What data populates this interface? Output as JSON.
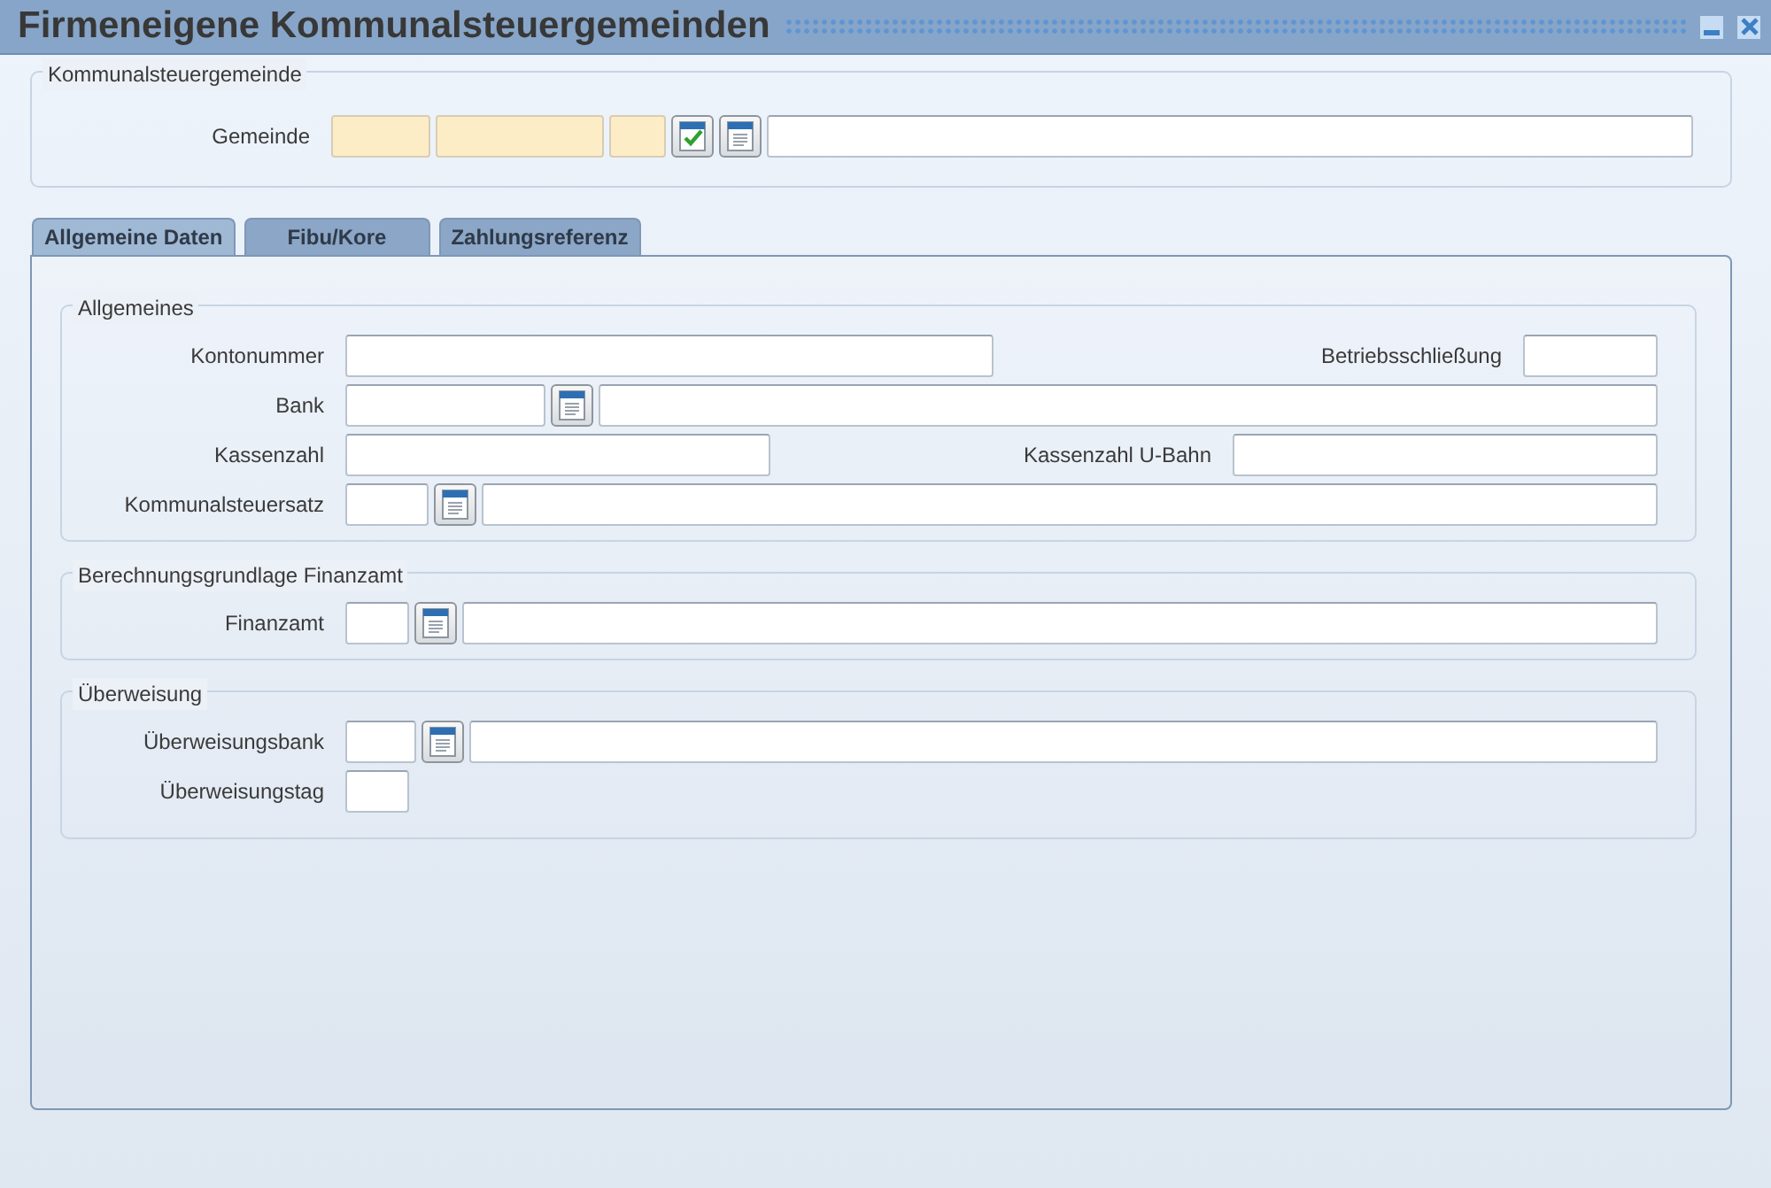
{
  "window": {
    "title": "Firmeneigene Kommunalsteuergemeinden"
  },
  "header_group": {
    "legend": "Kommunalsteuergemeinde",
    "rows": [
      {
        "label": "Gemeinde",
        "items": [
          {
            "kind": "field",
            "required": true
          },
          {
            "kind": "field",
            "required": true
          },
          {
            "kind": "field",
            "required": true
          },
          {
            "kind": "check-button"
          },
          {
            "kind": "list-button"
          },
          {
            "kind": "field",
            "required": false
          }
        ]
      }
    ]
  },
  "tabs": [
    {
      "label": "Allgemeine Daten",
      "selected": true
    },
    {
      "label": "Fibu/Kore",
      "selected": false
    },
    {
      "label": "Zahlungsreferenz",
      "selected": false
    }
  ],
  "groups": [
    {
      "legend": "Allgemeines",
      "rows": [
        {
          "label": "Kontonummer",
          "items": [
            {
              "kind": "field",
              "required": false
            },
            {
              "kind": "label",
              "text": "Betriebsschließung"
            },
            {
              "kind": "field",
              "required": false
            }
          ]
        },
        {
          "label": "Bank",
          "items": [
            {
              "kind": "field",
              "required": false
            },
            {
              "kind": "list-button"
            },
            {
              "kind": "field",
              "required": false
            }
          ]
        },
        {
          "label": "Kassenzahl",
          "items": [
            {
              "kind": "field",
              "required": false
            },
            {
              "kind": "label",
              "text": "Kassenzahl U-Bahn"
            },
            {
              "kind": "field",
              "required": false
            }
          ]
        },
        {
          "label": "Kommunalsteuersatz",
          "items": [
            {
              "kind": "field",
              "required": false
            },
            {
              "kind": "list-button"
            },
            {
              "kind": "field",
              "required": false
            }
          ]
        }
      ]
    },
    {
      "legend": "Berechnungsgrundlage Finanzamt",
      "rows": [
        {
          "label": "Finanzamt",
          "items": [
            {
              "kind": "field",
              "required": false
            },
            {
              "kind": "list-button"
            },
            {
              "kind": "field",
              "required": false
            }
          ]
        }
      ]
    },
    {
      "legend": "Überweisung",
      "rows": [
        {
          "label": "Überweisungsbank",
          "items": [
            {
              "kind": "field",
              "required": false
            },
            {
              "kind": "list-button"
            },
            {
              "kind": "field",
              "required": false
            }
          ]
        },
        {
          "label": "Überweisungstag",
          "items": [
            {
              "kind": "field",
              "required": false
            }
          ]
        }
      ]
    }
  ]
}
